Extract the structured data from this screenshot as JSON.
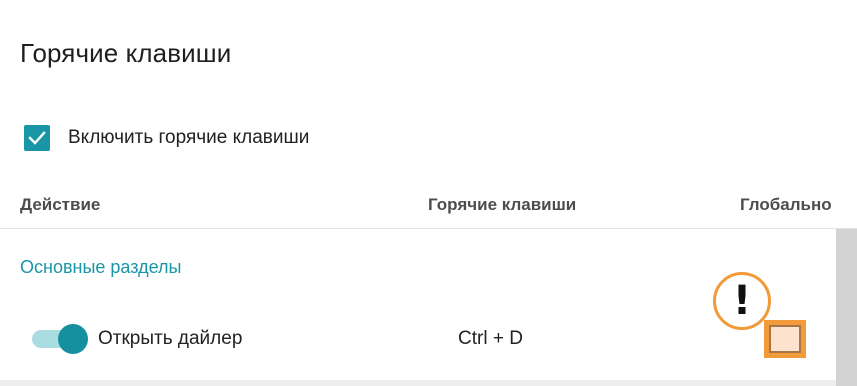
{
  "page_title": "Горячие клавиши",
  "enable_hotkeys": {
    "label": "Включить горячие клавиши",
    "checked": true,
    "icon": "check-icon"
  },
  "columns": {
    "action": "Действие",
    "hotkeys": "Горячие клавиши",
    "global": "Глобально"
  },
  "sections": [
    {
      "title": "Основные разделы",
      "rows": [
        {
          "label": "Открыть дайлер",
          "enabled": true,
          "keys": "Ctrl + D",
          "global": false,
          "warning_mark": "!"
        }
      ]
    }
  ],
  "colors": {
    "accent": "#1996a6",
    "highlight": "#f39b3a"
  }
}
